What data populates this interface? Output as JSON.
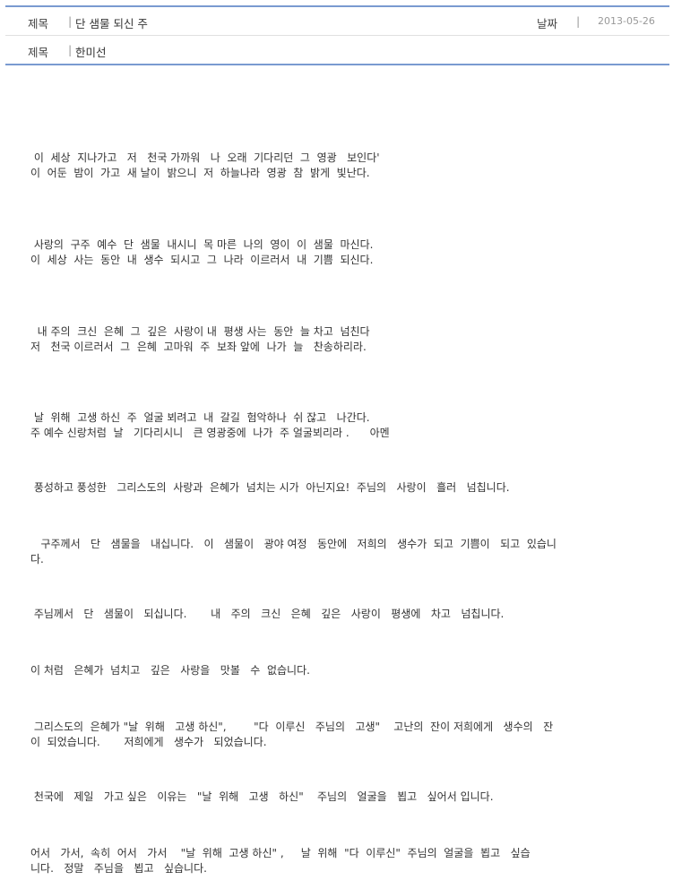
{
  "meta": {
    "title_label": "제목",
    "title_value": "단 샘물 되신 주",
    "date_label": "날짜",
    "date_value": "2013-05-26",
    "author_label": "제목",
    "author_value": "한미선"
  },
  "body": {
    "p1": " 이  세상  지나가고   저   천국 가까워   나  오래  기다리던  그  영광   보인다'\n이  어둔  밤이  가고  새 날이  밝으니  저  하늘나라  영광  참  밝게  빛난다.",
    "p2": " 사랑의  구주  예수  단  샘물  내시니  목 마른  나의  영이  이  샘물  마신다.\n이  세상  사는  동안  내  생수  되시고  그  나라  이르러서  내  기쁨  되신다.",
    "p3": "  내 주의  크신  은혜  그  깊은  사랑이 내  평생 사는  동안  늘 차고  넘친다\n저   천국 이르러서  그  은혜  고마워  주  보좌 앞에  나가  늘   찬송하리라.",
    "p4": " 날  위해  고생 하신  주  얼굴 뵈려고  내  갈길  험악하나  쉬 잖고   나간다.\n주 예수 신랑처럼  날   기다리시니   큰 영광중에  나가  주 얼굴뵈리라 .      아멘",
    "p5": " 풍성하고 풍성한   그리스도의  사랑과  은혜가  넘치는 시가  아닌지요!  주님의   사랑이   흘러   넘칩니다.",
    "p6": "   구주께서   단   샘물을   내십니다.   이   샘물이   광야 여정   동안에   저희의   생수가  되고  기쁨이   되고  있습니\n다.",
    "p7": " 주님께서   단   샘물이   되십니다.       내   주의   크신   은혜   깊은   사랑이   평생에   차고   넘칩니다.",
    "p8": "이 처럼   은혜가  넘치고   깊은   사랑을   맛볼   수  없습니다.",
    "p9": " 그리스도의  은혜가 \"날  위해   고생 하신\",        \"다  이루신   주님의   고생\"    고난의  잔이 저희에게   생수의   잔\n이  되었습니다.       저희에게   생수가   되었습니다.",
    "p10": " 천국에   제일   가고 싶은   이유는   \"날  위해   고생   하신\"    주님의   얼굴을   뵙고   싶어서 입니다.",
    "p11": "어서   가서,  속히  어서   가서    \"날  위해  고생 하신\" ,     날  위해  \"다  이루신\"  주님의  얼굴을  뵙고   싶습\n니다.   정말   주님을   뵙고   싶습니다."
  }
}
